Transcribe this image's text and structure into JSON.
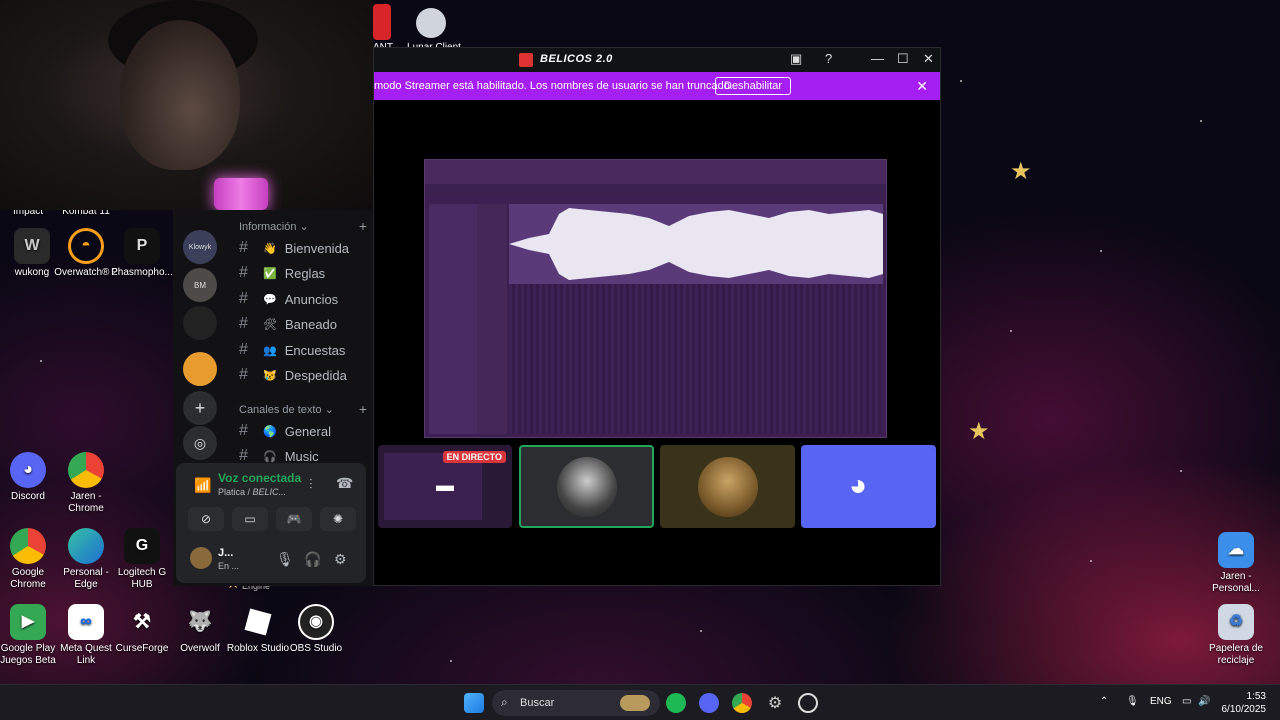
{
  "desktop": {
    "top_labels": [
      "Impact",
      "Kombat 11",
      "PANT",
      "Lunar Client"
    ],
    "icons_col1": [
      {
        "label": "wukong",
        "icon": "wukong-icon"
      },
      {
        "label": "Overwatch® 2",
        "icon": "overwatch-icon"
      },
      {
        "label": "Phasmopho...",
        "icon": "phasmophobia-icon"
      }
    ],
    "icons_mid": [
      {
        "label": "Discord",
        "icon": "discord-icon"
      },
      {
        "label": "Jaren - Chrome",
        "icon": "chrome-icon"
      }
    ],
    "icons_row": [
      {
        "label": "Google Chrome",
        "icon": "chrome-icon"
      },
      {
        "label": "Personal - Edge",
        "icon": "edge-icon"
      },
      {
        "label": "Logitech G HUB",
        "icon": "logitech-icon"
      }
    ],
    "icons_bottom": [
      {
        "label": "Google Play Juegos Beta",
        "icon": "google-play-icon"
      },
      {
        "label": "Meta Quest Link",
        "icon": "meta-icon"
      },
      {
        "label": "CurseForge",
        "icon": "curseforge-icon"
      },
      {
        "label": "Overwolf",
        "icon": "overwolf-icon"
      },
      {
        "label": "Roblox Studio",
        "icon": "roblox-icon"
      },
      {
        "label": "OBS Studio",
        "icon": "obs-icon"
      }
    ],
    "right_icons": [
      {
        "label": "Jaren - Personal...",
        "icon": "onedrive-folder-icon"
      },
      {
        "label": "Papelera de reciclaje",
        "icon": "recycle-bin-icon"
      }
    ],
    "partial_label": "Engine"
  },
  "discord": {
    "categories": {
      "info": "Información",
      "text": "Canales de texto"
    },
    "channels_info": [
      {
        "emoji": "👋",
        "name": "Bienvenida"
      },
      {
        "emoji": "✅",
        "name": "Reglas"
      },
      {
        "emoji": "💬",
        "name": "Anuncios"
      },
      {
        "emoji": "🛠",
        "name": "Baneado"
      },
      {
        "emoji": "👥",
        "name": "Encuestas"
      },
      {
        "emoji": "😿",
        "name": "Despedida"
      }
    ],
    "channels_text": [
      {
        "emoji": "🌎",
        "name": "General"
      },
      {
        "emoji": "🎧",
        "name": "Music"
      }
    ],
    "server_labels": [
      "Klowyk",
      "BM"
    ],
    "voice": {
      "status": "Voz conectada",
      "channel": "Platica",
      "server": "BELIC..."
    },
    "user": {
      "name": "J...",
      "status": "En ..."
    }
  },
  "stream_window": {
    "title": "BELICOS 2.0",
    "banner_text": "modo Streamer está habilitado. Los nombres de usuario se han truncado.",
    "banner_button": "Deshabilitar",
    "live_badge": "EN DIRECTO"
  },
  "taskbar": {
    "search_placeholder": "Buscar",
    "language": "ENG",
    "time": "1:53",
    "date": "6/10/2025"
  },
  "colors": {
    "banner": "#a61ff2",
    "voice_green": "#23a55a",
    "discord_blurple": "#5865f2",
    "live_red": "#da373c"
  }
}
